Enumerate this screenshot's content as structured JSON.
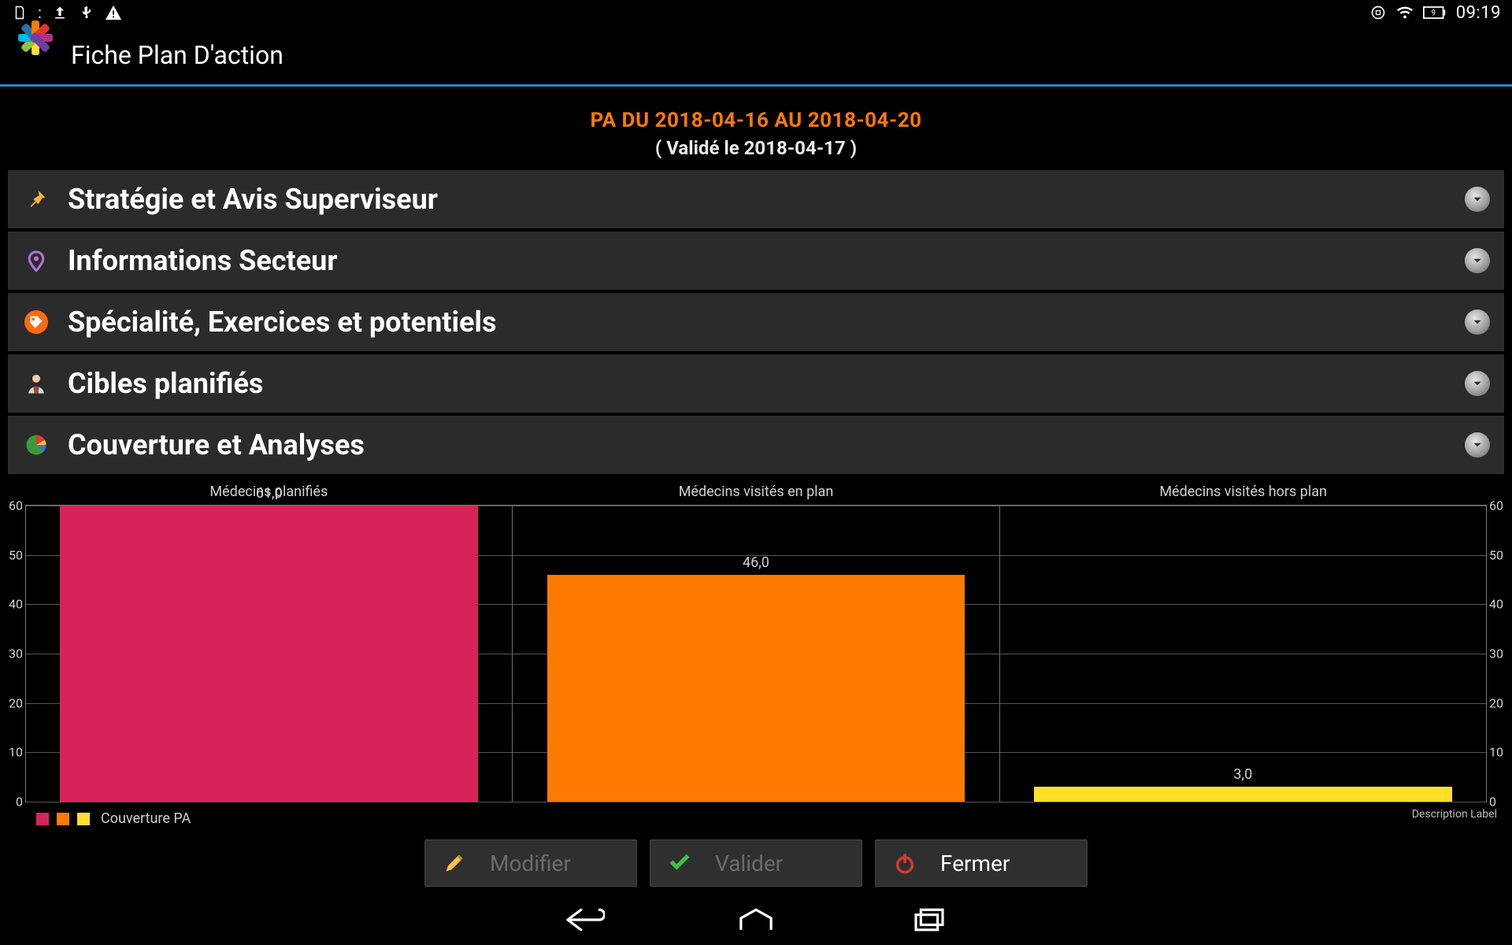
{
  "status": {
    "clock": "09:19",
    "battery_level": 9
  },
  "appbar": {
    "title": "Fiche Plan D'action"
  },
  "headline": {
    "line1": "PA DU 2018-04-16 AU 2018-04-20",
    "line2": "( Validé le 2018-04-17 )"
  },
  "accordion": {
    "items": [
      {
        "label": "Stratégie et Avis Superviseur",
        "icon": "pin-icon"
      },
      {
        "label": "Informations Secteur",
        "icon": "location-icon"
      },
      {
        "label": "Spécialité, Exercices et potentiels",
        "icon": "tag-icon"
      },
      {
        "label": "Cibles planifiés",
        "icon": "person-icon"
      },
      {
        "label": "Couverture et Analyses",
        "icon": "pie-icon"
      }
    ]
  },
  "chart_data": {
    "type": "bar",
    "categories": [
      "Médecins planifiés",
      "Médecins visités en plan",
      "Médecins visités hors plan"
    ],
    "values": [
      61.0,
      46.0,
      3.0
    ],
    "value_labels": [
      "61,0",
      "46,0",
      "3,0"
    ],
    "colors": [
      "#d6245b",
      "#ff7a00",
      "#ffdf2b"
    ],
    "ylim": [
      0,
      60
    ],
    "yticks": [
      0,
      10,
      20,
      30,
      40,
      50,
      60
    ],
    "legend": "Couverture PA",
    "description_label": "Description Label"
  },
  "actions": {
    "modify": "Modifier",
    "validate": "Valider",
    "close": "Fermer"
  }
}
